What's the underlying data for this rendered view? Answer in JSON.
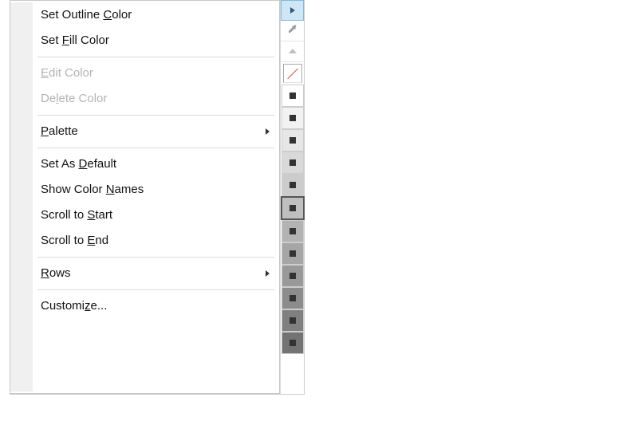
{
  "menu": {
    "items": [
      {
        "pre": "Set Outline ",
        "acc": "C",
        "post": "olor",
        "disabled": false
      },
      {
        "pre": "Set ",
        "acc": "F",
        "post": "ill Color",
        "disabled": false
      },
      "sep",
      {
        "pre": "",
        "acc": "E",
        "post": "dit Color",
        "disabled": true
      },
      {
        "pre": "De",
        "acc": "l",
        "post": "ete Color",
        "disabled": true
      },
      "sep",
      {
        "pre": "",
        "acc": "P",
        "post": "alette",
        "disabled": false,
        "submenu": true
      },
      "sep",
      {
        "pre": "Set As ",
        "acc": "D",
        "post": "efault",
        "disabled": false
      },
      {
        "pre": "Show Color ",
        "acc": "N",
        "post": "ames",
        "disabled": false
      },
      {
        "pre": "Scroll to ",
        "acc": "S",
        "post": "tart",
        "disabled": false
      },
      {
        "pre": "Scroll to ",
        "acc": "E",
        "post": "nd",
        "disabled": false
      },
      "sep",
      {
        "pre": "",
        "acc": "R",
        "post": "ows",
        "disabled": false,
        "submenu": true
      },
      "sep",
      {
        "pre": "Customi",
        "acc": "z",
        "post": "e...",
        "disabled": false
      }
    ]
  },
  "palette": {
    "top_buttons": [
      {
        "name": "flyout-arrow",
        "active": true
      },
      {
        "name": "eyedropper",
        "active": false
      },
      {
        "name": "scroll-up",
        "active": false
      }
    ],
    "has_none_swatch": true,
    "swatches": [
      {
        "fill": "#ffffff",
        "selected": false
      },
      {
        "fill": "#f2f2f2",
        "selected": false
      },
      {
        "fill": "#e6e6e6",
        "selected": false
      },
      {
        "fill": "#d9d9d9",
        "selected": false
      },
      {
        "fill": "#cccccc",
        "selected": false
      },
      {
        "fill": "#bfbfbf",
        "selected": true
      },
      {
        "fill": "#b3b3b3",
        "selected": false
      },
      {
        "fill": "#a6a6a6",
        "selected": false
      },
      {
        "fill": "#999999",
        "selected": false
      },
      {
        "fill": "#8c8c8c",
        "selected": false
      },
      {
        "fill": "#808080",
        "selected": false
      },
      {
        "fill": "#737373",
        "selected": false
      }
    ]
  }
}
